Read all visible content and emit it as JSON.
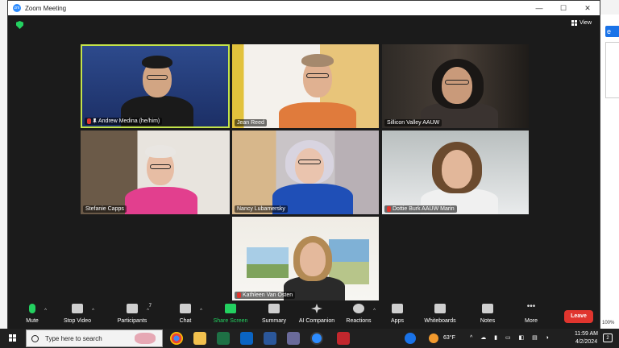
{
  "window": {
    "title": "Zoom Meeting",
    "minimize": "—",
    "maximize": "☐",
    "close": "✕"
  },
  "view_label": "View",
  "participants_tiles": [
    {
      "name": "Andrew Medina (he/him)"
    },
    {
      "name": "Jean Reed"
    },
    {
      "name": "Sillicon Valley AAUW"
    },
    {
      "name": "Stefanie Capps"
    },
    {
      "name": "Nancy Lubamersky"
    },
    {
      "name": "Dottie Burk AAUW Marin"
    },
    {
      "name": "Kathleen Van Osten"
    }
  ],
  "toolbar": {
    "mute": "Mute",
    "stop_video": "Stop Video",
    "participants": "Participants",
    "participants_count": "7",
    "chat": "Chat",
    "share_screen": "Share Screen",
    "summary": "Summary",
    "ai_companion": "AI Companion",
    "reactions": "Reactions",
    "apps": "Apps",
    "whiteboards": "Whiteboards",
    "notes": "Notes",
    "more": "More",
    "leave": "Leave"
  },
  "taskbar": {
    "search_placeholder": "Type here to search",
    "weather": "63°F",
    "time": "11:59 AM",
    "date": "4/2/2024",
    "notifications_count": "2"
  },
  "background_app": {
    "zoom_percent": "100%"
  },
  "colors": {
    "accent_green": "#23d160",
    "leave_red": "#e0352e",
    "active_speaker_border": "#c3e34a",
    "zoom_blue": "#2d8cff"
  }
}
